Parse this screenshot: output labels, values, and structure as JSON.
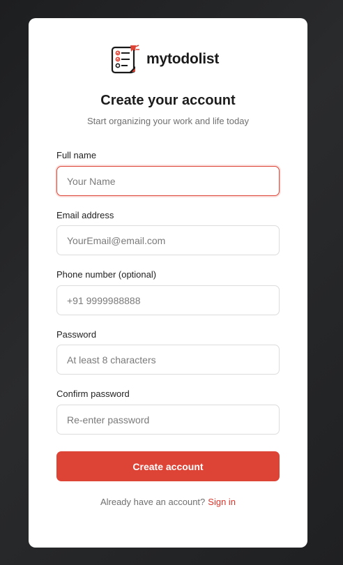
{
  "brand": {
    "name": "mytodolist",
    "icon": "todo-list-icon"
  },
  "header": {
    "title": "Create your account",
    "subtitle": "Start organizing your work and life today"
  },
  "form": {
    "full_name": {
      "label": "Full name",
      "placeholder": "Your Name",
      "value": ""
    },
    "email": {
      "label": "Email address",
      "placeholder": "YourEmail@email.com",
      "value": ""
    },
    "phone": {
      "label": "Phone number (optional)",
      "placeholder": "+91 9999988888",
      "value": ""
    },
    "password": {
      "label": "Password",
      "placeholder": "At least 8 characters",
      "value": ""
    },
    "confirm_password": {
      "label": "Confirm password",
      "placeholder": "Re-enter password",
      "value": ""
    }
  },
  "actions": {
    "submit_label": "Create account"
  },
  "footer": {
    "prompt": "Already have an account?",
    "link": "Sign in"
  },
  "colors": {
    "accent": "#de4436",
    "background": "#1f2022",
    "card": "#ffffff"
  }
}
